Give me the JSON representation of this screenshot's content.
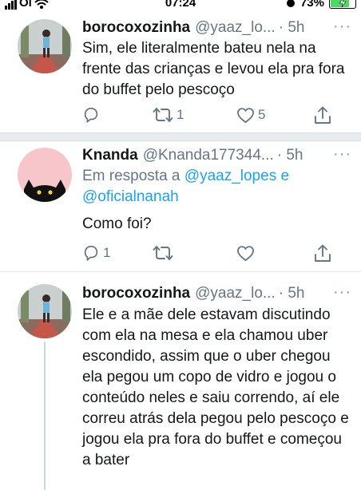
{
  "status_bar": {
    "carrier": "Oi",
    "time": "07:24",
    "battery": "73%"
  },
  "tweets": [
    {
      "name": "borocoxozinha",
      "handle": "@yaaz_lo...",
      "time": "· 5h",
      "more": "···",
      "text": "Sim, ele literalmente bateu nela na frente das crianças e levou ela pra fora do buffet pelo pescoço",
      "retweets": "1",
      "likes": "5"
    },
    {
      "name": "Knanda",
      "handle": "@Knanda177344...",
      "time": "· 5h",
      "more": "···",
      "reply_prefix": "Em resposta a",
      "reply_user_1": "@yaaz_lopes",
      "reply_joiner": "e",
      "reply_user_2": "@oficialnanah",
      "text": "Como foi?",
      "replies": "1"
    },
    {
      "name": "borocoxozinha",
      "handle": "@yaaz_lo...",
      "time": "· 5h",
      "more": "···",
      "text": "Ele e a mãe dele estavam discutindo com ela na mesa e ela chamou uber escondido, assim que o uber chegou ela pegou um copo de vidro e jogou o conteúdo neles e saiu correndo, aí ele correu atrás dela pegou pelo pescoço e jogou ela pra fora do buffet e começou a bater"
    }
  ],
  "colors": {
    "link": "#1da1f2",
    "secondary_text": "#657786",
    "separator": "#e6ecf0",
    "avatar_knanda": "#f6c6cb"
  },
  "icons": [
    "wifi-icon",
    "alarm-icon",
    "charging-bolt-icon",
    "reply-icon",
    "retweet-icon",
    "like-icon",
    "share-icon",
    "more-icon"
  ]
}
